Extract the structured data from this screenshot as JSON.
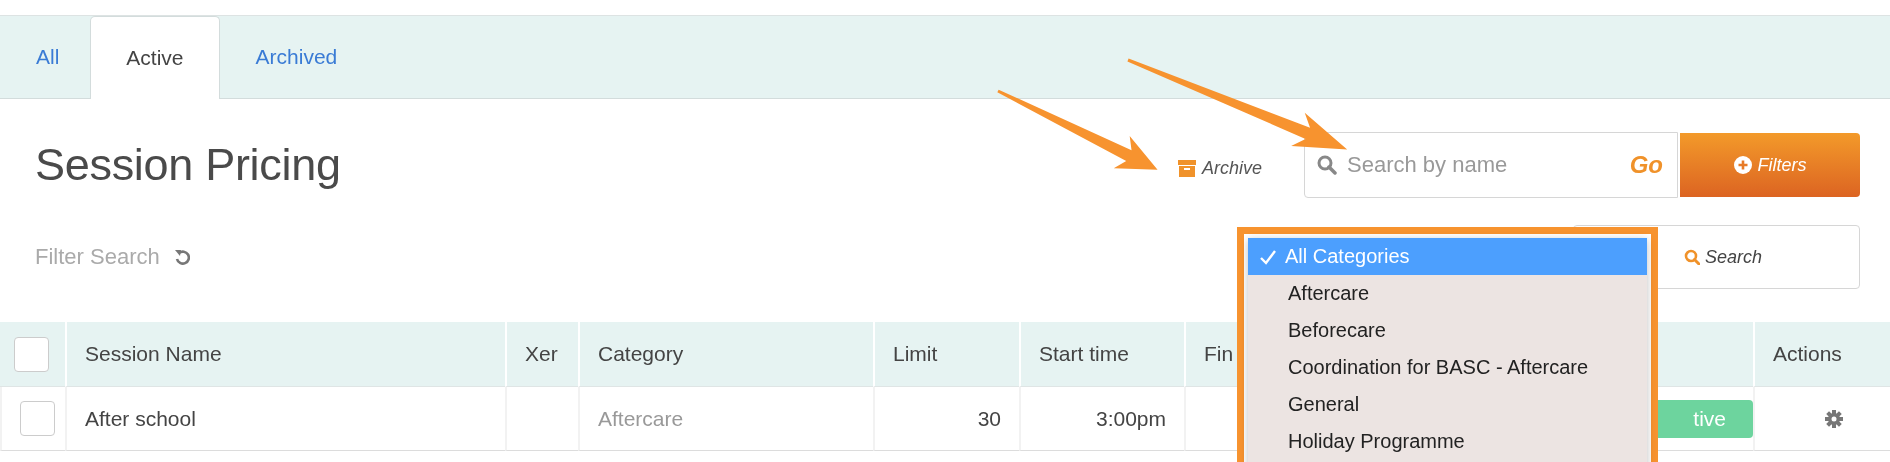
{
  "tabs": [
    {
      "label": "All",
      "selected": false
    },
    {
      "label": "Active",
      "selected": true
    },
    {
      "label": "Archived",
      "selected": false
    }
  ],
  "page_title": "Session Pricing",
  "archive_link": "Archive",
  "name_search": {
    "placeholder": "Search by name",
    "go": "Go"
  },
  "filters_button": "Filters",
  "filter_search": "Filter Search",
  "search_button": "Search",
  "table": {
    "select_all_checked": false,
    "columns": [
      "Session Name",
      "Xer",
      "Category",
      "Limit",
      "Start time",
      "Fin",
      "Actions"
    ],
    "rows": [
      {
        "checked": false,
        "session_name": "After school",
        "category": "Aftercare",
        "limit": "30",
        "start_time": "3:00pm",
        "status": "tive"
      }
    ]
  },
  "category_dropdown": {
    "options": [
      {
        "label": "All Categories",
        "selected": true
      },
      {
        "label": "Aftercare",
        "selected": false
      },
      {
        "label": "Beforecare",
        "selected": false
      },
      {
        "label": "Coordination for BASC - Aftercare",
        "selected": false
      },
      {
        "label": "General",
        "selected": false
      },
      {
        "label": "Holiday Programme",
        "selected": false
      }
    ]
  }
}
